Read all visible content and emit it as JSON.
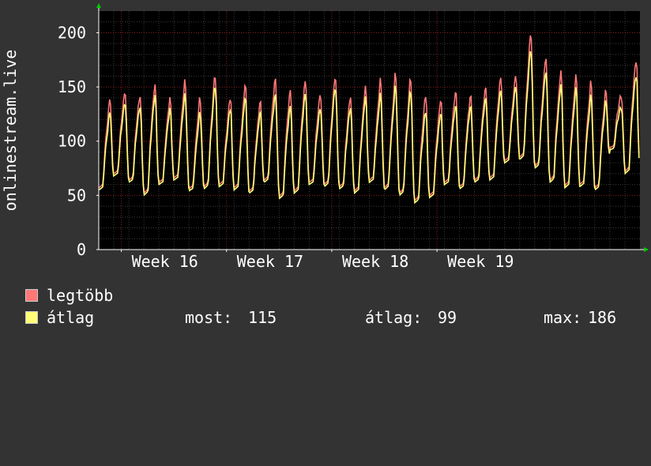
{
  "chart_data": {
    "type": "line",
    "ylabel": "onlinestream.live",
    "ylim": [
      0,
      220
    ],
    "yticks": [
      0,
      50,
      100,
      150,
      200
    ],
    "xticks": [
      "Week 16",
      "Week 17",
      "Week 18",
      "Week 19"
    ],
    "grid": true,
    "legend_placement": "bottom-left",
    "colors": {
      "background": "#333333",
      "plot": "#000000",
      "grid_minor": "#3a3a3a",
      "grid_major": "#8a2020",
      "axis": "#ffffff",
      "max_series": "#ff7777",
      "avg_series": "#ffff77",
      "arrow": "#00cc00"
    },
    "days": [
      {
        "max": 140,
        "avg": 128,
        "min": 55
      },
      {
        "max": 148,
        "avg": 138,
        "min": 68
      },
      {
        "max": 145,
        "avg": 135,
        "min": 62
      },
      {
        "max": 155,
        "avg": 145,
        "min": 50
      },
      {
        "max": 140,
        "avg": 130,
        "min": 60
      },
      {
        "max": 155,
        "avg": 142,
        "min": 64
      },
      {
        "max": 140,
        "avg": 126,
        "min": 54
      },
      {
        "max": 162,
        "avg": 152,
        "min": 56
      },
      {
        "max": 140,
        "avg": 130,
        "min": 58
      },
      {
        "max": 152,
        "avg": 140,
        "min": 55
      },
      {
        "max": 138,
        "avg": 128,
        "min": 52
      },
      {
        "max": 160,
        "avg": 145,
        "min": 62
      },
      {
        "max": 150,
        "avg": 135,
        "min": 47
      },
      {
        "max": 158,
        "avg": 146,
        "min": 52
      },
      {
        "max": 145,
        "avg": 132,
        "min": 60
      },
      {
        "max": 162,
        "avg": 152,
        "min": 58
      },
      {
        "max": 142,
        "avg": 132,
        "min": 56
      },
      {
        "max": 150,
        "avg": 140,
        "min": 52
      },
      {
        "max": 155,
        "avg": 141,
        "min": 62
      },
      {
        "max": 162,
        "avg": 150,
        "min": 55
      },
      {
        "max": 160,
        "avg": 148,
        "min": 50
      },
      {
        "max": 145,
        "avg": 130,
        "min": 43
      },
      {
        "max": 140,
        "avg": 128,
        "min": 48
      },
      {
        "max": 148,
        "avg": 135,
        "min": 60
      },
      {
        "max": 145,
        "avg": 135,
        "min": 56
      },
      {
        "max": 152,
        "avg": 142,
        "min": 62
      },
      {
        "max": 160,
        "avg": 148,
        "min": 64
      },
      {
        "max": 160,
        "avg": 150,
        "min": 80
      },
      {
        "max": 200,
        "avg": 185,
        "min": 83
      },
      {
        "max": 178,
        "avg": 165,
        "min": 75
      },
      {
        "max": 165,
        "avg": 152,
        "min": 62
      },
      {
        "max": 160,
        "avg": 148,
        "min": 57
      },
      {
        "max": 155,
        "avg": 142,
        "min": 58
      },
      {
        "max": 150,
        "avg": 140,
        "min": 55
      },
      {
        "max": 145,
        "avg": 134,
        "min": 92
      },
      {
        "max": 178,
        "avg": 164,
        "min": 70
      }
    ],
    "series": [
      {
        "name": "legtöbb",
        "color": "#ff7777"
      },
      {
        "name": "átlag",
        "color": "#ffff77"
      }
    ],
    "stats": {
      "most_label": "most:",
      "most_value": "115",
      "atlag_label": "átlag:",
      "atlag_value": "99",
      "max_label": "max:",
      "max_value": "186"
    }
  }
}
